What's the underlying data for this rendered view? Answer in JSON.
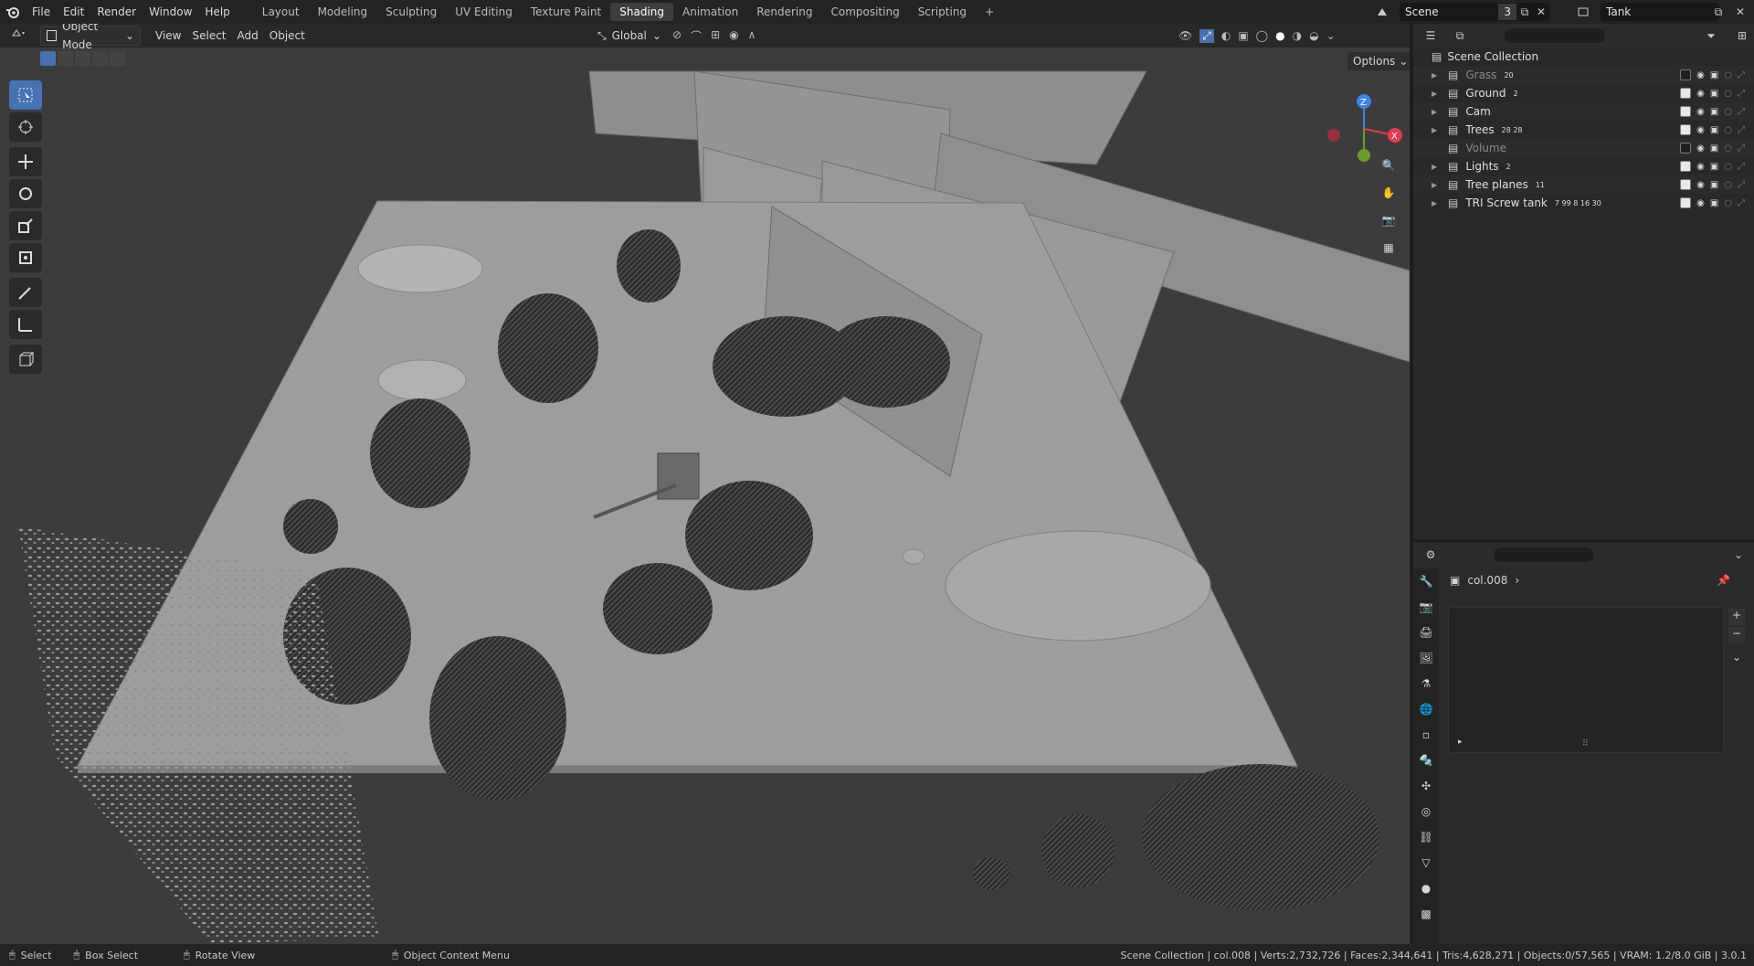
{
  "topbar": {
    "menus": [
      "File",
      "Edit",
      "Render",
      "Window",
      "Help"
    ],
    "workspaces": [
      "Layout",
      "Modeling",
      "Sculpting",
      "UV Editing",
      "Texture Paint",
      "Shading",
      "Animation",
      "Rendering",
      "Compositing",
      "Scripting"
    ],
    "active_workspace": "Shading",
    "add_tab": "+",
    "scene_name": "Scene",
    "scene_users": "3",
    "view_layer": "Tank"
  },
  "viewport": {
    "mode": "Object Mode",
    "menus": [
      "View",
      "Select",
      "Add",
      "Object"
    ],
    "orientation": "Global",
    "options_label": "Options",
    "gizmo_axes": {
      "z": "Z",
      "x": "X"
    }
  },
  "outliner": {
    "root": "Scene Collection",
    "rows": [
      {
        "name": "Grass",
        "dim": true,
        "badge": "20",
        "checked": false
      },
      {
        "name": "Ground",
        "dim": false,
        "badge": "2",
        "checked": true
      },
      {
        "name": "Cam",
        "dim": false,
        "badge": "",
        "checked": true
      },
      {
        "name": "Trees",
        "dim": false,
        "badge": "28  28",
        "checked": true
      },
      {
        "name": "Volume",
        "dim": true,
        "badge": "",
        "checked": false
      },
      {
        "name": "Lights",
        "dim": false,
        "badge": "2",
        "checked": true
      },
      {
        "name": "Tree planes",
        "dim": false,
        "badge": "11",
        "checked": true
      },
      {
        "name": "TRI Screw tank",
        "dim": false,
        "badge": "7  99  8  16  30",
        "checked": true
      }
    ]
  },
  "properties": {
    "object_name": "col.008"
  },
  "statusbar": {
    "select": "Select",
    "box_select": "Box Select",
    "rotate": "Rotate View",
    "context": "Object Context Menu",
    "stats": "Scene Collection | col.008 | Verts:2,732,726 | Faces:2,344,641 | Tris:4,628,271 | Objects:0/57,565 | VRAM: 1.2/8.0 GiB | 3.0.1"
  },
  "colors": {
    "accent": "#4772b3",
    "axis_x": "#e83a4f",
    "axis_y": "#6a9e2c",
    "axis_z": "#3f83e8"
  }
}
